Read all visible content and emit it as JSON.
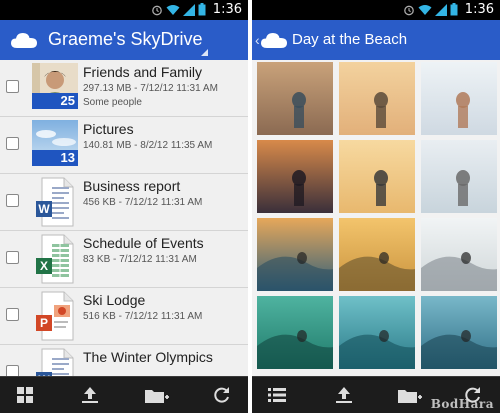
{
  "status": {
    "time": "1:36"
  },
  "left": {
    "title": "Graeme's SkyDrive",
    "items": [
      {
        "name": "Friends and Family",
        "meta": "297.13 MB - 7/12/12 11:31 AM",
        "sub": "Some people",
        "count": "25",
        "kind": "album-people"
      },
      {
        "name": "Pictures",
        "meta": "140.81 MB - 8/2/12 11:35 AM",
        "count": "13",
        "kind": "album-sky"
      },
      {
        "name": "Business report",
        "meta": "456 KB - 7/12/12 11:31 AM",
        "kind": "word"
      },
      {
        "name": "Schedule of Events",
        "meta": "83 KB - 7/12/12 11:31 AM",
        "kind": "excel"
      },
      {
        "name": "Ski Lodge",
        "meta": "516 KB - 7/12/12 11:31 AM",
        "kind": "powerpoint"
      },
      {
        "name": "The Winter Olympics",
        "meta": "",
        "kind": "word"
      }
    ],
    "doc_letters": {
      "word": "W",
      "excel": "X",
      "powerpoint": "P"
    }
  },
  "right": {
    "title": "Day at the Beach",
    "photos": [
      "surfers-walking",
      "woman-portrait",
      "woman-smiling",
      "surfer-sunset",
      "surfer-shore",
      "surfers-group",
      "wave-rock",
      "surfer-jump",
      "surfer-spray",
      "surfer-barrel",
      "surfer-crest",
      "surfer-ride"
    ]
  },
  "toolbar": {
    "left": [
      "grid-view-icon",
      "upload-icon",
      "new-folder-icon",
      "refresh-icon"
    ],
    "right": [
      "list-view-icon",
      "upload-icon",
      "new-folder-icon",
      "refresh-icon"
    ]
  },
  "colors": {
    "appbar": "#2a5cc8",
    "count_badge": "#1f55c0",
    "word": "#2b579a",
    "excel": "#217346",
    "powerpoint": "#d24726"
  },
  "watermark": "BodHara"
}
